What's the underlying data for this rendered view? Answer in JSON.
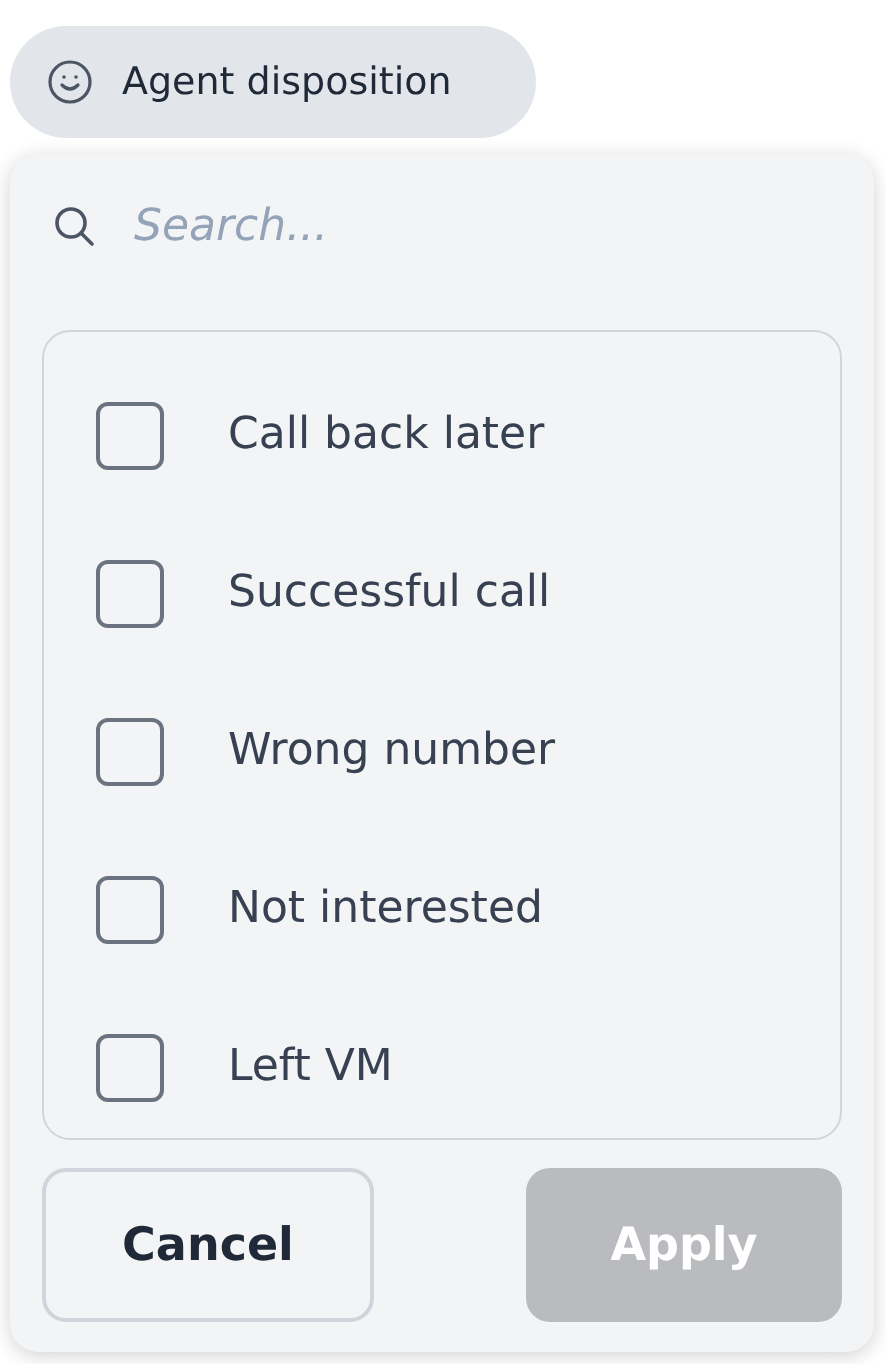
{
  "filter_chip": {
    "label": "Agent disposition"
  },
  "search": {
    "placeholder": "Search..."
  },
  "options": [
    {
      "label": "Call back later",
      "checked": false
    },
    {
      "label": "Successful call",
      "checked": false
    },
    {
      "label": "Wrong number",
      "checked": false
    },
    {
      "label": "Not interested",
      "checked": false
    },
    {
      "label": "Left VM",
      "checked": false
    }
  ],
  "buttons": [
    {
      "label": "Cancel",
      "kind": "secondary",
      "disabled": false
    },
    {
      "label": "Apply",
      "kind": "primary",
      "disabled": true
    }
  ]
}
